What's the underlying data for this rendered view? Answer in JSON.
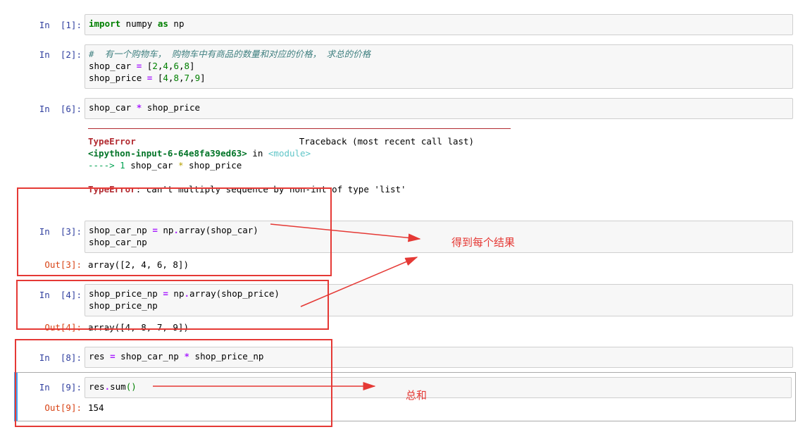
{
  "cells": [
    {
      "id": "c1",
      "in_prompt": "In  [1]:",
      "code": [
        "import numpy as np"
      ]
    },
    {
      "id": "c2",
      "in_prompt": "In  [2]:",
      "code": [
        "#  有一个购物车， 购物车中有商品的数量和对应的价格， 求总的价格",
        "shop_car = [2,4,6,8]",
        "shop_price = [4,8,7,9]"
      ]
    },
    {
      "id": "c6",
      "in_prompt": "In  [6]:",
      "code": [
        "shop_car * shop_price"
      ],
      "traceback": {
        "error_name": "TypeError",
        "header_right": "Traceback (most recent call last)",
        "location_file": "<ipython-input-6-64e8fa39ed63>",
        "location_in": " in ",
        "location_module": "<module>",
        "arrow_line": "----> 1 shop_car * shop_price",
        "message": ": can't multiply sequence by non-int of type 'list'"
      }
    },
    {
      "id": "c3",
      "in_prompt": "In  [3]:",
      "code": [
        "shop_car_np = np.array(shop_car)",
        "shop_car_np"
      ],
      "out_prompt": "Out[3]:",
      "output": "array([2, 4, 6, 8])"
    },
    {
      "id": "c4",
      "in_prompt": "In  [4]:",
      "code": [
        "shop_price_np = np.array(shop_price)",
        "shop_price_np"
      ],
      "out_prompt": "Out[4]:",
      "output": "array([4, 8, 7, 9])"
    },
    {
      "id": "c8",
      "in_prompt": "In  [8]:",
      "code": [
        "res = shop_car_np * shop_price_np"
      ]
    },
    {
      "id": "c9",
      "in_prompt": "In  [9]:",
      "code": [
        "res.sum()"
      ],
      "out_prompt": "Out[9]:",
      "output": "154"
    }
  ],
  "annotations": {
    "each_result": "得到每个结果",
    "total": "总和"
  },
  "colors": {
    "annotation_red": "#e53935",
    "prompt_in": "#303f9f",
    "prompt_out": "#d84315",
    "selected_bar": "#42a5f5"
  }
}
